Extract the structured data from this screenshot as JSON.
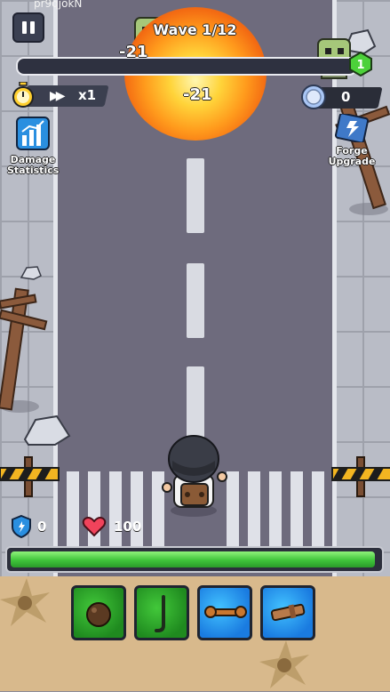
{
  "hud": {
    "player_id": "pr9qjokN",
    "wave_label": "Wave 1/12",
    "wave_progress": 0.0,
    "wave_level": "1",
    "speed_label": "x1",
    "coins": "0",
    "damage_numbers": [
      "-21",
      "-21"
    ]
  },
  "side_buttons": {
    "damage_statistics": "Damage Statistics",
    "forge_upgrade": "Forge Upgrade"
  },
  "stats": {
    "shield": "0",
    "health": "100",
    "health_fraction": 1.0
  },
  "skills": [
    {
      "icon": "cannonball-icon",
      "color": "green"
    },
    {
      "icon": "crowbar-icon",
      "color": "green"
    },
    {
      "icon": "wrench-icon",
      "color": "blue"
    },
    {
      "icon": "pipe-icon",
      "color": "blue"
    }
  ],
  "colors": {
    "road": "#6e6b7d",
    "health_bar": "#3fc43a",
    "panel": "#d8b98c"
  }
}
